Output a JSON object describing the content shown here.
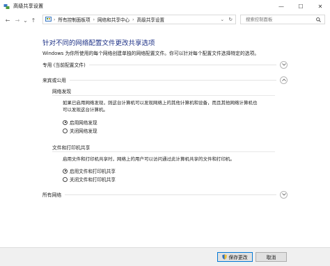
{
  "window": {
    "title": "高级共享设置",
    "controls": [
      "—",
      "☐",
      "✕"
    ]
  },
  "nav": {
    "back": "←",
    "forward": "→",
    "dropdown": "⌄",
    "up": "↑",
    "breadcrumbs": [
      "所有控制面板项",
      "网络和共享中心",
      "高级共享设置"
    ],
    "refresh": "↻"
  },
  "search": {
    "placeholder": "搜索控制面板"
  },
  "main": {
    "heading": "针对不同的网络配置文件更改共享选项",
    "description": "Windows 为你所使用的每个网络创建单独的网络配置文件。你可以针对每个配置文件选择特定的选项。",
    "sections": [
      {
        "label": "专用 (当前配置文件)",
        "expanded": false
      },
      {
        "label": "来宾或公用",
        "expanded": true
      },
      {
        "label": "所有网络",
        "expanded": false
      }
    ],
    "network_discovery": {
      "title": "网络发现",
      "desc_line1": "如果已启用网络发现，则这台计算机可以发现网络上的其他计算机和设备，而且其他网络计算机也",
      "desc_line2": "可以发现这台计算机。",
      "options": [
        "启用网络发现",
        "关闭网络发现"
      ],
      "selected": 0
    },
    "file_printer_sharing": {
      "title": "文件和打印机共享",
      "desc": "启用文件和打印机共享时，网络上的用户可以访问通过此计算机共享的文件和打印机。",
      "options": [
        "启用文件和打印机共享",
        "关闭文件和打印机共享"
      ],
      "selected": 0
    }
  },
  "footer": {
    "save": "保存更改",
    "cancel": "取消"
  }
}
